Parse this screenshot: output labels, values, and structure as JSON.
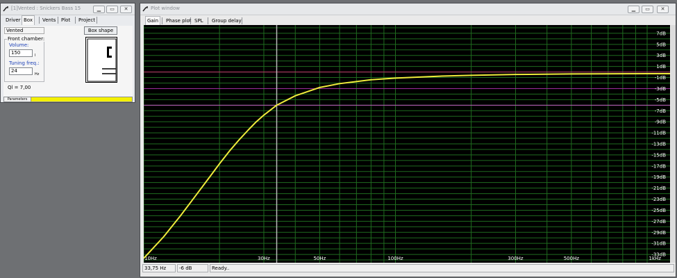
{
  "left_window": {
    "title": "[1]Vented : Snickers Bass 15",
    "tabs": [
      "Driver",
      "Box",
      "Vents",
      "Plot",
      "Project"
    ],
    "active_tab": "Box",
    "box_type": "Vented",
    "box_shape_button": "Box shape",
    "front_chamber_label": "Front chamber:",
    "volume_label": "Volume:",
    "volume_value": "150",
    "volume_unit": "l",
    "tuning_label": "Tuning freq.:",
    "tuning_value": "24",
    "tuning_unit": "Hz",
    "ql": "Ql = 7,00",
    "parameters_label": "Parameters"
  },
  "plot_window": {
    "title": "Plot window",
    "tabs": [
      "Gain",
      "Phase plot",
      "SPL",
      "Group delay"
    ],
    "active_tab": "Gain",
    "status": {
      "freq": "33,75 Hz",
      "db": "-6 dB",
      "message": "Ready.."
    }
  },
  "chart_data": {
    "type": "line",
    "x_scale": "log",
    "xlim": [
      10,
      1000
    ],
    "ylim": [
      -34.5,
      8.5
    ],
    "x_tick_labels": [
      {
        "value": 10,
        "label": "10Hz"
      },
      {
        "value": 30,
        "label": "30Hz"
      },
      {
        "value": 50,
        "label": "50Hz"
      },
      {
        "value": 100,
        "label": "100Hz"
      },
      {
        "value": 300,
        "label": "300Hz"
      },
      {
        "value": 500,
        "label": "500Hz"
      },
      {
        "value": 1000,
        "label": "1kHz"
      }
    ],
    "y_tick_labels": [
      7,
      5,
      3,
      1,
      -1,
      -3,
      -5,
      -7,
      -9,
      -11,
      -13,
      -15,
      -17,
      -19,
      -21,
      -23,
      -25,
      -27,
      -29,
      -31,
      -33
    ],
    "y_unit": "dB",
    "reference_lines": [
      {
        "y": 0,
        "color": "#c0306a"
      },
      {
        "y": -3,
        "color": "#9a2d9a"
      },
      {
        "y": -6,
        "color": "#c25cc2"
      }
    ],
    "cursor_x": 33.75,
    "series": [
      {
        "color": "#f0ec3c",
        "x": [
          10,
          12,
          14,
          16,
          18,
          20,
          22,
          24,
          26,
          28,
          30,
          33.75,
          40,
          50,
          60,
          80,
          100,
          150,
          200,
          300,
          500,
          1000
        ],
        "y": [
          -33.7,
          -29.8,
          -26.0,
          -22.5,
          -19.4,
          -16.6,
          -14.2,
          -12.2,
          -10.5,
          -9.0,
          -7.8,
          -6.0,
          -4.3,
          -2.8,
          -2.1,
          -1.4,
          -1.1,
          -0.75,
          -0.6,
          -0.45,
          -0.35,
          -0.3
        ]
      }
    ]
  }
}
